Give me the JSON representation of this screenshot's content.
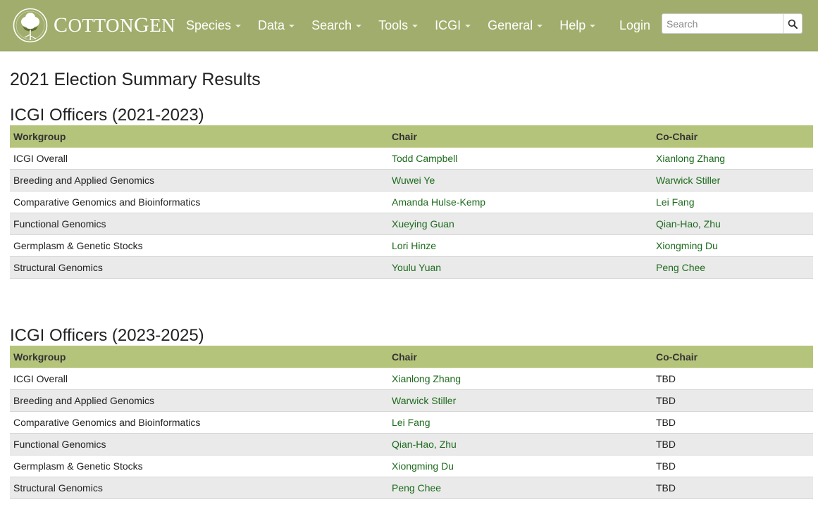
{
  "header": {
    "logo_text_first": "C",
    "logo_text_rest": "OTTON",
    "logo_text_second": "G",
    "logo_text_second_rest": "EN",
    "nav": [
      {
        "label": "Species"
      },
      {
        "label": "Data"
      },
      {
        "label": "Search"
      },
      {
        "label": "Tools"
      },
      {
        "label": "ICGI"
      },
      {
        "label": "General"
      },
      {
        "label": "Help"
      }
    ],
    "login_label": "Login",
    "search_placeholder": "Search",
    "colors": {
      "nav_bg": "#a0ad6c",
      "table_header": "#b5c47b",
      "link": "#1d6a1d"
    }
  },
  "page_title": "2021 Election Summary Results",
  "sections": [
    {
      "title": "ICGI Officers (2021-2023)",
      "columns": [
        "Workgroup",
        "Chair",
        "Co-Chair"
      ],
      "rows": [
        [
          "ICGI Overall",
          "Todd Campbell",
          "Xianlong Zhang"
        ],
        [
          "Breeding and Applied Genomics",
          "Wuwei Ye",
          "Warwick Stiller"
        ],
        [
          "Comparative Genomics and Bioinformatics",
          "Amanda Hulse-Kemp",
          "Lei Fang"
        ],
        [
          "Functional Genomics",
          "Xueying Guan",
          "Qian-Hao, Zhu"
        ],
        [
          "Germplasm & Genetic Stocks",
          "Lori Hinze",
          "Xiongming Du"
        ],
        [
          "Structural Genomics",
          "Youlu Yuan",
          "Peng Chee"
        ]
      ]
    },
    {
      "title": "ICGI Officers (2023-2025)",
      "columns": [
        "Workgroup",
        "Chair",
        "Co-Chair"
      ],
      "rows": [
        [
          "ICGI Overall",
          "Xianlong Zhang",
          "TBD"
        ],
        [
          "Breeding and Applied Genomics",
          "Warwick Stiller",
          "TBD"
        ],
        [
          "Comparative Genomics and Bioinformatics",
          "Lei Fang",
          "TBD"
        ],
        [
          "Functional Genomics",
          "Qian-Hao, Zhu",
          "TBD"
        ],
        [
          "Germplasm & Genetic Stocks",
          "Xiongming Du",
          "TBD"
        ],
        [
          "Structural Genomics",
          "Peng Chee",
          "TBD"
        ]
      ]
    }
  ]
}
